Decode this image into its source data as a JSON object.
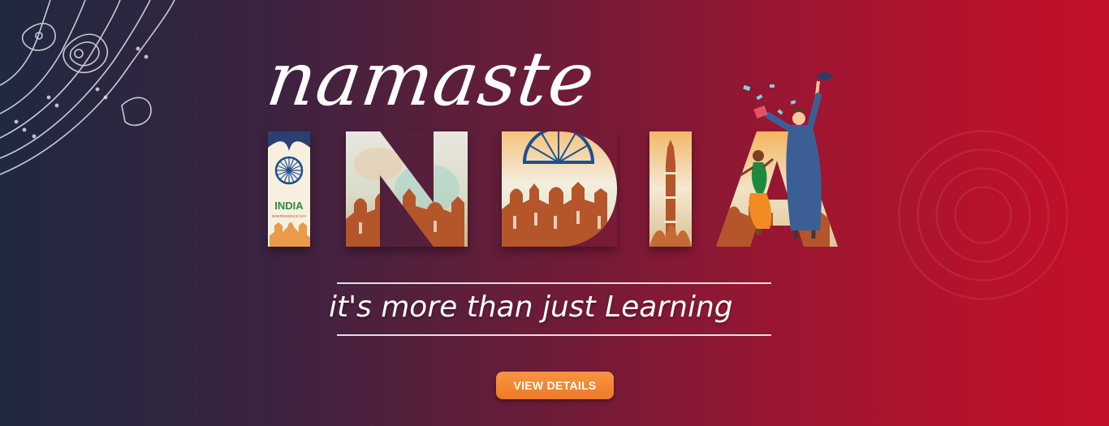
{
  "banner": {
    "script_word": "namaste",
    "title_letters": [
      "I",
      "N",
      "D",
      "I",
      "A"
    ],
    "badge_title": "INDIA",
    "badge_subtitle": "INDEPENDENCE DAY",
    "tagline": "it's more than just Learning",
    "cta_label": "VIEW DETAILS"
  },
  "colors": {
    "bg_left": "#1f2940",
    "bg_right": "#c40f2a",
    "cta": "#f07d2a",
    "saffron": "#f28b22",
    "green": "#2e8b3a",
    "chakra": "#1d4f91",
    "monument": "#b4552a"
  },
  "icons": [
    "paisley-ornament-icon",
    "ashoka-chakra-icon",
    "graduate-figure-icon",
    "dancer-figure-icon",
    "mortarboard-icon"
  ]
}
